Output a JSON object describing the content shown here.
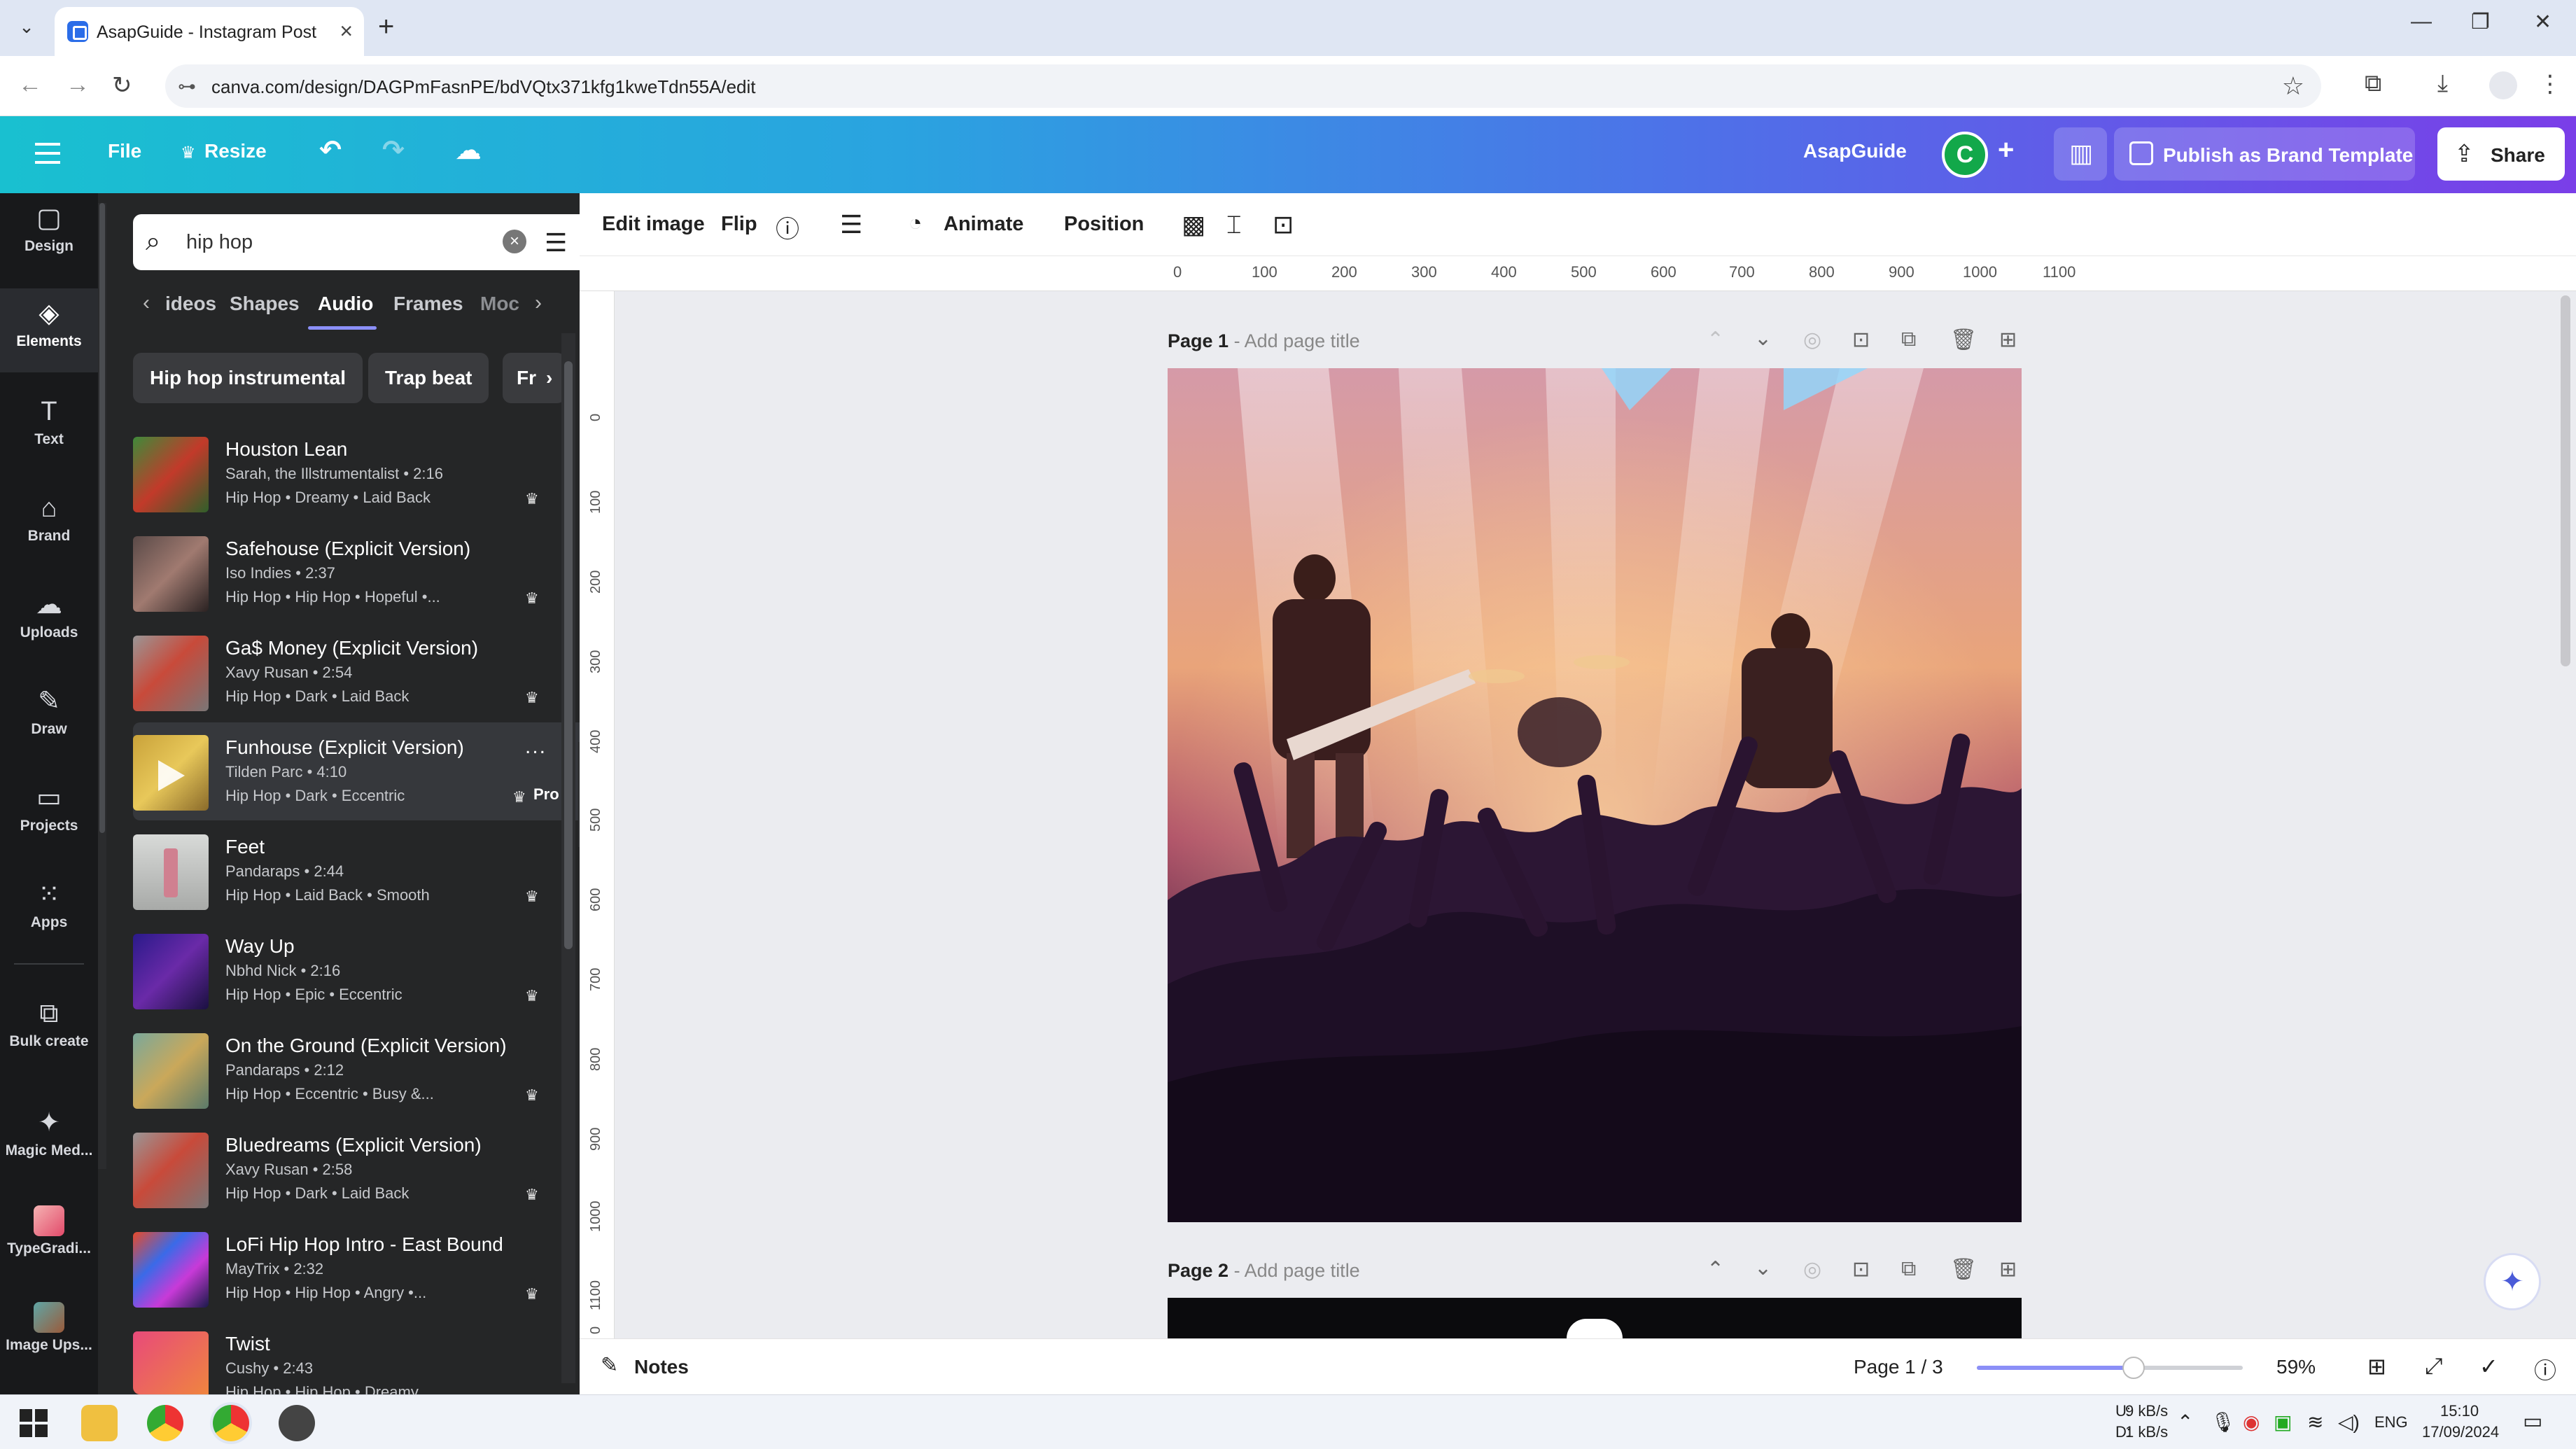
{
  "browser": {
    "tab_title": "AsapGuide - Instagram Post",
    "url": "canva.com/design/DAGPmFasnPE/bdVQtx371kfg1kweTdn55A/edit"
  },
  "header": {
    "file": "File",
    "resize": "Resize",
    "team_name": "AsapGuide",
    "avatar_letter": "C",
    "publish_label": "Publish as Brand Template",
    "share_label": "Share"
  },
  "rail": [
    {
      "label": "Design",
      "icon": "design-icon",
      "glyph": "▢"
    },
    {
      "label": "Elements",
      "icon": "elements-icon",
      "glyph": "◈"
    },
    {
      "label": "Text",
      "icon": "text-icon",
      "glyph": "T"
    },
    {
      "label": "Brand",
      "icon": "brand-icon",
      "glyph": "⌂"
    },
    {
      "label": "Uploads",
      "icon": "uploads-icon",
      "glyph": "☁"
    },
    {
      "label": "Draw",
      "icon": "draw-icon",
      "glyph": "✎"
    },
    {
      "label": "Projects",
      "icon": "projects-icon",
      "glyph": "▭"
    },
    {
      "label": "Apps",
      "icon": "apps-icon",
      "glyph": "⁙"
    },
    {
      "label": "Bulk create",
      "icon": "bulk-create-icon",
      "glyph": "⧉"
    },
    {
      "label": "Magic Med...",
      "icon": "magic-media-icon",
      "glyph": "✦"
    },
    {
      "label": "TypeGradi...",
      "icon": "typegradient-app-icon",
      "glyph": ""
    },
    {
      "label": "Image Ups...",
      "icon": "image-upscaler-app-icon",
      "glyph": ""
    }
  ],
  "search": {
    "value": "hip hop"
  },
  "content_tabs": [
    "ideos",
    "Shapes",
    "Audio",
    "Frames",
    "Moc"
  ],
  "active_tab": "Audio",
  "chips": [
    "Hip hop instrumental",
    "Trap beat",
    "Fr"
  ],
  "tracks": [
    {
      "title": "Houston Lean",
      "meta": "Sarah, the Illstrumentalist • 2:16",
      "tags": "Hip Hop • Dreamy • Laid Back"
    },
    {
      "title": "Safehouse (Explicit Version)",
      "meta": "Iso Indies • 2:37",
      "tags": "Hip Hop • Hip Hop • Hopeful •..."
    },
    {
      "title": "Ga$ Money (Explicit Version)",
      "meta": "Xavy Rusan • 2:54",
      "tags": "Hip Hop • Dark • Laid Back"
    },
    {
      "title": "Funhouse (Explicit Version)",
      "meta": "Tilden Parc • 4:10",
      "tags": "Hip Hop • Dark • Eccentric",
      "badge": "Pro",
      "more": "..."
    },
    {
      "title": "Feet",
      "meta": "Pandaraps • 2:44",
      "tags": "Hip Hop • Laid Back • Smooth"
    },
    {
      "title": "Way Up",
      "meta": "Nbhd Nick • 2:16",
      "tags": "Hip Hop • Epic • Eccentric"
    },
    {
      "title": "On the Ground (Explicit Version)",
      "meta": "Pandaraps • 2:12",
      "tags": "Hip Hop • Eccentric • Busy &..."
    },
    {
      "title": "Bluedreams (Explicit Version)",
      "meta": "Xavy Rusan • 2:58",
      "tags": "Hip Hop • Dark • Laid Back"
    },
    {
      "title": "LoFi Hip Hop Intro - East Bound",
      "meta": "MayTrix • 2:32",
      "tags": "Hip Hop • Hip Hop • Angry •..."
    },
    {
      "title": "Twist",
      "meta": "Cushy • 2:43",
      "tags": "Hip Hop • Hip Hop • Dreamy"
    }
  ],
  "toolbar": {
    "edit_image": "Edit image",
    "flip": "Flip",
    "animate": "Animate",
    "position": "Position"
  },
  "ruler_h": [
    "0",
    "100",
    "200",
    "300",
    "400",
    "500",
    "600",
    "700",
    "800",
    "900",
    "1000",
    "1100"
  ],
  "ruler_v": [
    "0",
    "100",
    "200",
    "300",
    "400",
    "500",
    "600",
    "700",
    "800",
    "900",
    "1000",
    "1100",
    "0"
  ],
  "page1": {
    "label": "Page 1",
    "title_placeholder": "Add page title"
  },
  "page2": {
    "label": "Page 2",
    "title_placeholder": "Add page title"
  },
  "bottom": {
    "notes": "Notes",
    "page_indicator": "Page 1 / 3",
    "zoom": "59%",
    "zoom_fraction": 0.59
  },
  "taskbar": {
    "net_up_label": "U:",
    "net_down_label": "D:",
    "net_up": "9 kB/s",
    "net_down": "1 kB/s",
    "lang": "ENG",
    "time": "15:10",
    "date": "17/09/2024"
  },
  "colors": {
    "header_gradient_start": "#19c0d0",
    "header_gradient_end": "#7a3ee8",
    "panel_bg": "#252627",
    "rail_bg": "#18191b",
    "accent": "#8b8ff7"
  }
}
